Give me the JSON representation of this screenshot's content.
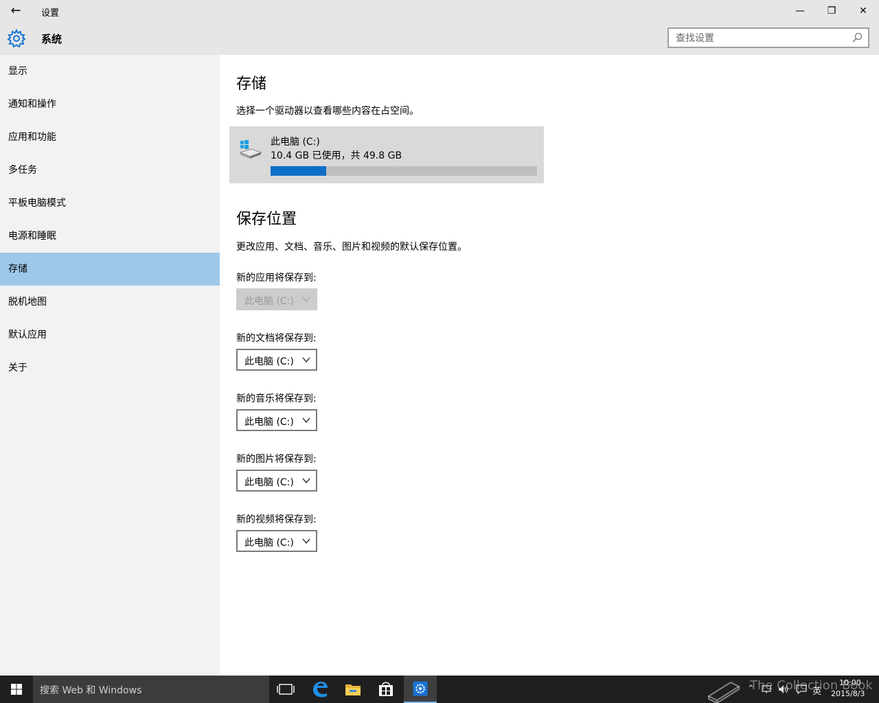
{
  "window": {
    "title": "设置",
    "back_glyph": "←",
    "minimize_glyph": "—",
    "restore_glyph": "❐",
    "close_glyph": "✕"
  },
  "header": {
    "section_title": "系统",
    "search_placeholder": "查找设置"
  },
  "sidebar": {
    "items": [
      {
        "label": "显示"
      },
      {
        "label": "通知和操作"
      },
      {
        "label": "应用和功能"
      },
      {
        "label": "多任务"
      },
      {
        "label": "平板电脑模式"
      },
      {
        "label": "电源和睡眠"
      },
      {
        "label": "存储",
        "selected": true
      },
      {
        "label": "脱机地图"
      },
      {
        "label": "默认应用"
      },
      {
        "label": "关于"
      }
    ]
  },
  "storage": {
    "heading": "存储",
    "description": "选择一个驱动器以查看哪些内容在占空间。",
    "drive": {
      "name": "此电脑 (C:)",
      "usage_text": "10.4 GB 已使用，共 49.8 GB",
      "used_fraction": 0.209
    }
  },
  "save_locations": {
    "heading": "保存位置",
    "description": "更改应用、文档、音乐、图片和视频的默认保存位置。",
    "items": [
      {
        "label": "新的应用将保存到:",
        "value": "此电脑 (C:)",
        "disabled": true
      },
      {
        "label": "新的文档将保存到:",
        "value": "此电脑 (C:)"
      },
      {
        "label": "新的音乐将保存到:",
        "value": "此电脑 (C:)"
      },
      {
        "label": "新的图片将保存到:",
        "value": "此电脑 (C:)"
      },
      {
        "label": "新的视频将保存到:",
        "value": "此电脑 (C:)"
      }
    ]
  },
  "taskbar": {
    "search_text": "搜索 Web 和 Windows",
    "ime": "英",
    "time": "10:00",
    "date": "2015/8/3",
    "watermark": "The Collection Book"
  },
  "colors": {
    "accent": "#0f6fc6",
    "selected_nav": "#9ec8ea",
    "sidebar_bg": "#f2f2f2",
    "header_bg": "#e6e6e6",
    "taskbar_bg": "#1f1f1f"
  }
}
